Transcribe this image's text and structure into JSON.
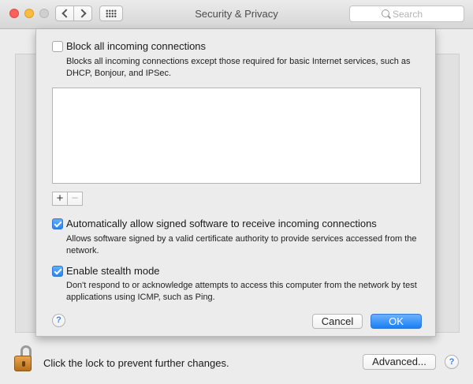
{
  "window": {
    "title": "Security & Privacy",
    "search_placeholder": "Search"
  },
  "sheet": {
    "block_all": {
      "label": "Block all incoming connections",
      "checked": false,
      "description_line1": "Blocks all incoming connections except those required for basic Internet services,  such as",
      "description_line2": "DHCP, Bonjour, and IPSec."
    },
    "app_list": {
      "items": [],
      "add_label": "+",
      "remove_label": "−"
    },
    "auto_allow_signed": {
      "label": "Automatically allow signed software to receive incoming connections",
      "checked": true,
      "description_line1": "Allows software signed by a valid certificate authority to provide services accessed from the",
      "description_line2": "network."
    },
    "stealth_mode": {
      "label": "Enable stealth mode",
      "checked": true,
      "description_line1": "Don't respond to or acknowledge attempts to access this computer from the network by test",
      "description_line2": "applications using ICMP, such as Ping."
    },
    "help_label": "?",
    "cancel_label": "Cancel",
    "ok_label": "OK"
  },
  "footer": {
    "lock_text": "Click the lock to prevent further changes.",
    "advanced_label": "Advanced...",
    "help_label": "?"
  },
  "colors": {
    "accent": "#2a84f3",
    "lock": "#d08a35"
  }
}
